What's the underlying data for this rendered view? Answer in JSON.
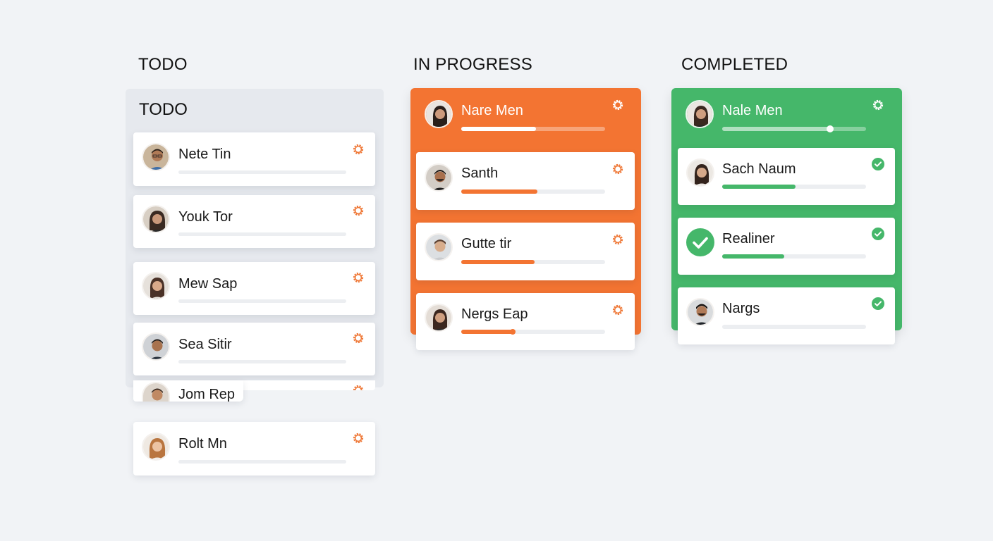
{
  "colors": {
    "background": "#f1f3f6",
    "todo_panel": "#e6e9ee",
    "in_progress": "#f37432",
    "completed": "#45b76a",
    "track": "#eceef1"
  },
  "columns": {
    "todo": {
      "heading": "TODO",
      "panel_title": "TODO",
      "cards": [
        {
          "name": "Nete Tin",
          "icon": "gear-icon",
          "progress": 0
        },
        {
          "name": "Youk Tor",
          "icon": "gear-icon",
          "progress": 0
        },
        {
          "name": "Mew Sap",
          "icon": "gear-icon",
          "progress": 0
        },
        {
          "name": "Sea Sitir",
          "icon": "gear-icon",
          "progress": 0
        },
        {
          "name": "Jom Rep",
          "icon": "gear-icon",
          "progress": 0
        },
        {
          "name": "Rolt Mn",
          "icon": "gear-icon",
          "progress": 0
        }
      ]
    },
    "in_progress": {
      "heading": "IN PROGRESS",
      "header_card": {
        "name": "Nare Men",
        "icon": "gear-icon",
        "progress": 0.52
      },
      "cards": [
        {
          "name": "Santh",
          "icon": "gear-icon",
          "progress": 0.53
        },
        {
          "name": "Gutte tir",
          "icon": "gear-icon",
          "progress": 0.51
        },
        {
          "name": "Nergs Eap",
          "icon": "gear-icon",
          "progress": 0.36
        }
      ]
    },
    "completed": {
      "heading": "COMPLETED",
      "header_card": {
        "name": "Nale Men",
        "icon": "gear-icon",
        "progress": 0.75
      },
      "cards": [
        {
          "name": "Sach Naum",
          "icon": "check-circle-icon",
          "progress": 0.51
        },
        {
          "name": "Realiner",
          "icon": "check-circle-icon",
          "progress": 0.43
        },
        {
          "name": "Nargs",
          "icon": "check-circle-icon",
          "progress": 0
        }
      ]
    }
  }
}
